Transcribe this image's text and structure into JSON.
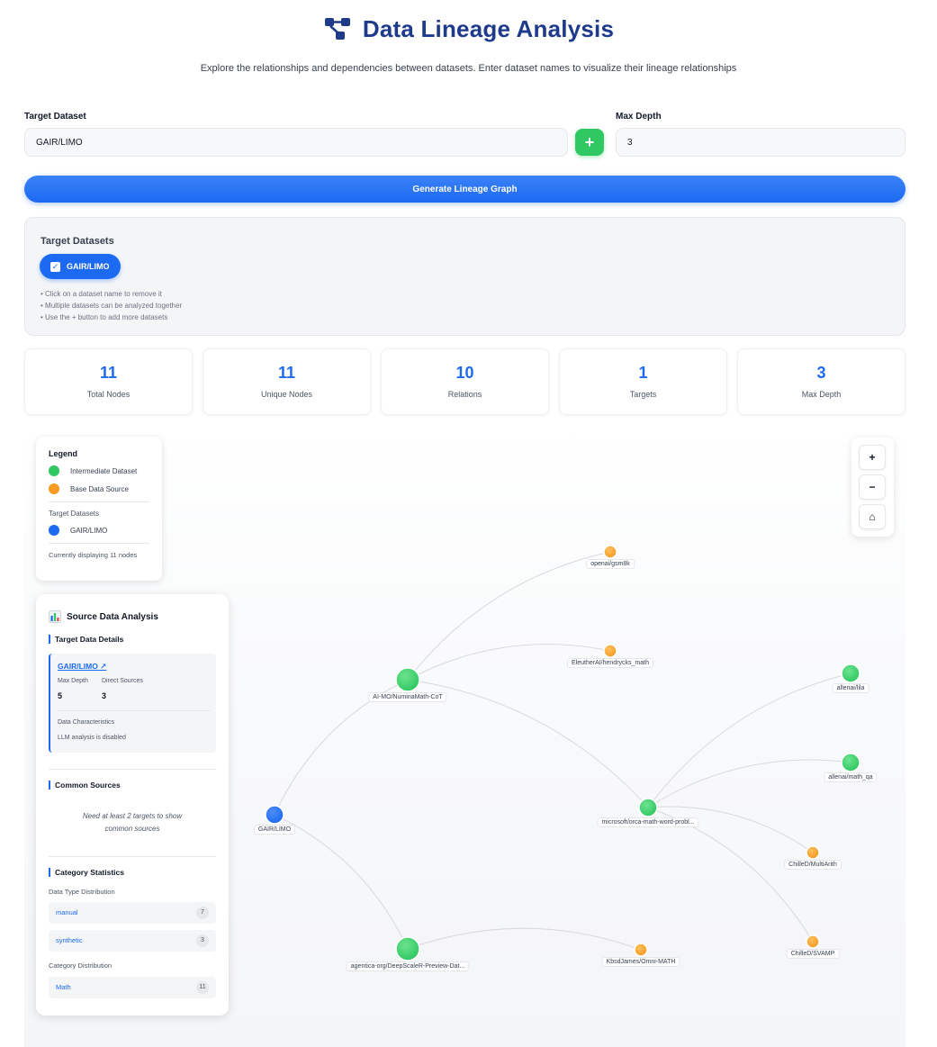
{
  "header": {
    "title": "Data Lineage Analysis",
    "subtitle": "Explore the relationships and dependencies between datasets. Enter dataset names to visualize their lineage relationships"
  },
  "form": {
    "target_label": "Target Dataset",
    "target_value": "GAIR/LIMO",
    "add_label": "+",
    "depth_label": "Max Depth",
    "depth_value": "3",
    "generate_label": "Generate Lineage Graph"
  },
  "targets": {
    "title": "Target Datasets",
    "chips": [
      "GAIR/LIMO"
    ],
    "hints": [
      "• Click on a dataset name to remove it",
      "• Multiple datasets can be analyzed together",
      "• Use the + button to add more datasets"
    ]
  },
  "stats": [
    {
      "value": "11",
      "label": "Total Nodes"
    },
    {
      "value": "11",
      "label": "Unique Nodes"
    },
    {
      "value": "10",
      "label": "Relations"
    },
    {
      "value": "1",
      "label": "Targets"
    },
    {
      "value": "3",
      "label": "Max Depth"
    }
  ],
  "legend": {
    "title": "Legend",
    "items": [
      {
        "label": "Intermediate Dataset",
        "color": "#2fc862"
      },
      {
        "label": "Base Data Source",
        "color": "#f59a23"
      }
    ],
    "targets_title": "Target Datasets",
    "targets": [
      {
        "label": "GAIR/LIMO",
        "color": "#1d6af2"
      }
    ],
    "footer": "Currently displaying 11 nodes"
  },
  "zoom": {
    "in": "+",
    "out": "−",
    "home": "⌂"
  },
  "graph": {
    "colors": {
      "target": "#1d6af2",
      "intermediate": "#2fc862",
      "base": "#f59a23"
    },
    "nodes": [
      {
        "id": "limo",
        "label": "GAIR/LIMO",
        "kind": "target"
      },
      {
        "id": "numina",
        "label": "AI-MO/NuminaMath-CoT",
        "kind": "intermediate"
      },
      {
        "id": "gsm8k",
        "label": "openai/gsm8k",
        "kind": "base"
      },
      {
        "id": "hendrycks",
        "label": "EleutherAI/hendrycks_math",
        "kind": "base"
      },
      {
        "id": "orca",
        "label": "microsoft/orca-math-word-probl...",
        "kind": "intermediate"
      },
      {
        "id": "lila",
        "label": "allenai/lila",
        "kind": "intermediate"
      },
      {
        "id": "mathqa",
        "label": "allenai/math_qa",
        "kind": "intermediate"
      },
      {
        "id": "multiarith",
        "label": "ChilleD/MultiArith",
        "kind": "base"
      },
      {
        "id": "svamp",
        "label": "ChilleD/SVAMP",
        "kind": "base"
      },
      {
        "id": "deepscale",
        "label": "agentica-org/DeepScaleR-Preview-Dat...",
        "kind": "intermediate"
      },
      {
        "id": "omni",
        "label": "KbsdJames/Omni-MATH",
        "kind": "base"
      }
    ],
    "edges": [
      [
        "limo",
        "numina"
      ],
      [
        "limo",
        "deepscale"
      ],
      [
        "numina",
        "gsm8k"
      ],
      [
        "numina",
        "hendrycks"
      ],
      [
        "numina",
        "orca"
      ],
      [
        "orca",
        "lila"
      ],
      [
        "orca",
        "mathqa"
      ],
      [
        "orca",
        "multiarith"
      ],
      [
        "orca",
        "svamp"
      ],
      [
        "deepscale",
        "omni"
      ]
    ]
  },
  "analysis": {
    "title": "Source Data Analysis",
    "target_details_title": "Target Data Details",
    "target_name": "GAIR/LIMO ↗",
    "max_depth_label": "Max Depth",
    "max_depth_value": "5",
    "direct_sources_label": "Direct Sources",
    "direct_sources_value": "3",
    "characteristics_label": "Data Characteristics",
    "characteristics_value": "LLM analysis is disabled",
    "common_title": "Common Sources",
    "common_note_1": "Need at least 2 targets to show",
    "common_note_2": "common sources",
    "category_title": "Category Statistics",
    "data_type_label": "Data Type Distribution",
    "data_types": [
      {
        "name": "manual",
        "count": "7"
      },
      {
        "name": "synthetic",
        "count": "3"
      }
    ],
    "category_label": "Category Distribution",
    "categories": [
      {
        "name": "Math",
        "count": "11"
      }
    ]
  }
}
